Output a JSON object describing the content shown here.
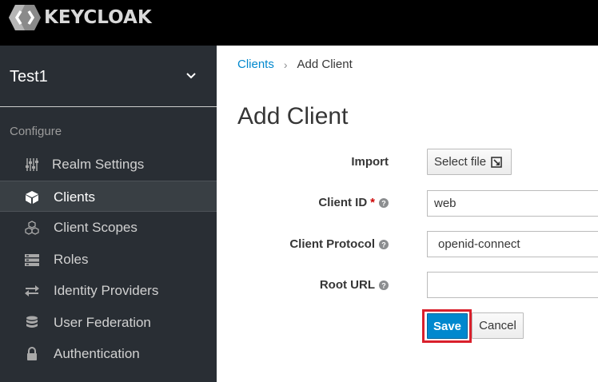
{
  "app": {
    "logo_text": "KEYCLOAK"
  },
  "sidebar": {
    "realm_name": "Test1",
    "section_label": "Configure",
    "items": [
      {
        "label": "Realm Settings",
        "icon": "sliders-icon",
        "active": false
      },
      {
        "label": "Clients",
        "icon": "cube-icon",
        "active": true
      },
      {
        "label": "Client Scopes",
        "icon": "cubes-icon",
        "active": false
      },
      {
        "label": "Roles",
        "icon": "list-icon",
        "active": false
      },
      {
        "label": "Identity Providers",
        "icon": "exchange-icon",
        "active": false
      },
      {
        "label": "User Federation",
        "icon": "database-icon",
        "active": false
      },
      {
        "label": "Authentication",
        "icon": "lock-icon",
        "active": false
      }
    ]
  },
  "breadcrumb": {
    "parent": "Clients",
    "separator": "›",
    "current": "Add Client"
  },
  "page": {
    "title": "Add Client"
  },
  "form": {
    "import_label": "Import",
    "select_file_label": "Select file",
    "client_id_label": "Client ID",
    "client_id_required": "*",
    "client_id_value": "web",
    "client_protocol_label": "Client Protocol",
    "client_protocol_value": "openid-connect",
    "root_url_label": "Root URL",
    "root_url_value": ""
  },
  "actions": {
    "save_label": "Save",
    "cancel_label": "Cancel"
  },
  "colors": {
    "primary": "#0088ce",
    "highlight": "#d9202c",
    "sidebar_bg": "#292e34"
  }
}
